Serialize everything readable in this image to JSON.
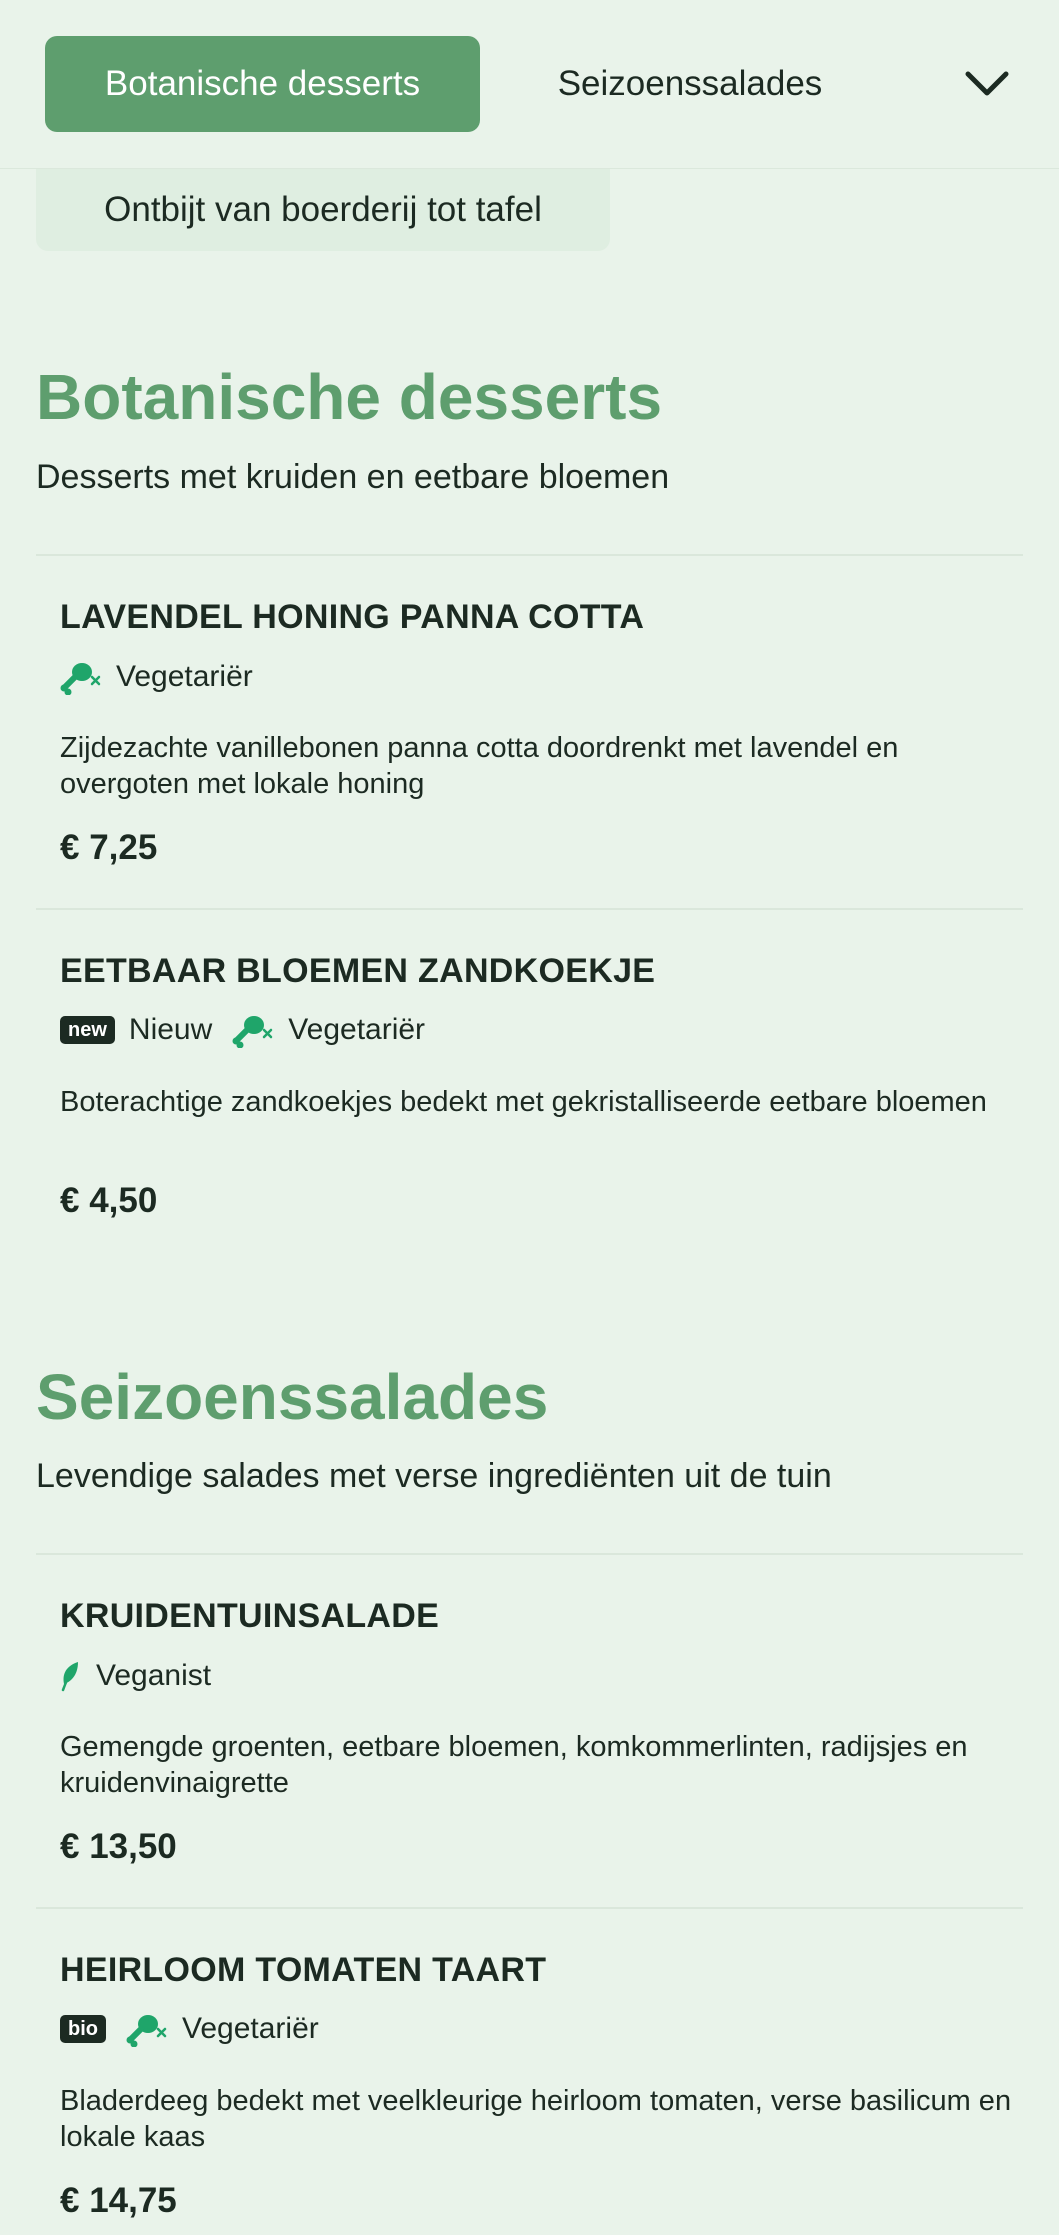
{
  "nav": {
    "tabs": [
      {
        "label": "Botanische desserts",
        "active": true
      },
      {
        "label": "Seizoenssalades",
        "active": false
      },
      {
        "label": "Ontbijt van boerderij tot tafel",
        "active": false
      }
    ],
    "expand_icon": "chevron-down-icon"
  },
  "colors": {
    "accent": "#5e9e6e",
    "background": "#e9f3ea",
    "tag_icon": "#1fa56a"
  },
  "sections": [
    {
      "title": "Botanische desserts",
      "subtitle": "Desserts met kruiden en eetbare bloemen",
      "items": [
        {
          "name": "LAVENDEL HONING PANNA COTTA",
          "tags": [
            {
              "type": "vegetarian",
              "icon": "drumstick-crossed-icon",
              "label": "Vegetariër"
            }
          ],
          "description": "Zijdezachte vanillebonen panna cotta doordrenkt met lavendel en overgoten met lokale honing",
          "price": "€ 7,25"
        },
        {
          "name": "EETBAAR BLOEMEN ZANDKOEKJE",
          "tags": [
            {
              "type": "badge",
              "badge": "new",
              "label": "Nieuw"
            },
            {
              "type": "vegetarian",
              "icon": "drumstick-crossed-icon",
              "label": "Vegetariër"
            }
          ],
          "description": "Boterachtige zandkoekjes bedekt met gekristalliseerde eetbare bloemen",
          "price": "€ 4,50"
        }
      ]
    },
    {
      "title": "Seizoenssalades",
      "subtitle": "Levendige salades met verse ingrediënten uit de tuin",
      "items": [
        {
          "name": "KRUIDENTUINSALADE",
          "tags": [
            {
              "type": "vegan",
              "icon": "leaf-icon",
              "label": "Veganist"
            }
          ],
          "description": "Gemengde groenten, eetbare bloemen, komkommerlinten, radijsjes en kruidenvinaigrette",
          "price": "€ 13,50"
        },
        {
          "name": "HEIRLOOM TOMATEN TAART",
          "tags": [
            {
              "type": "badge",
              "badge": "bio",
              "label": ""
            },
            {
              "type": "vegetarian",
              "icon": "drumstick-crossed-icon",
              "label": "Vegetariër"
            }
          ],
          "description": "Bladerdeeg bedekt met veelkleurige heirloom tomaten, verse basilicum en lokale kaas",
          "price": "€ 14,75"
        }
      ]
    }
  ]
}
